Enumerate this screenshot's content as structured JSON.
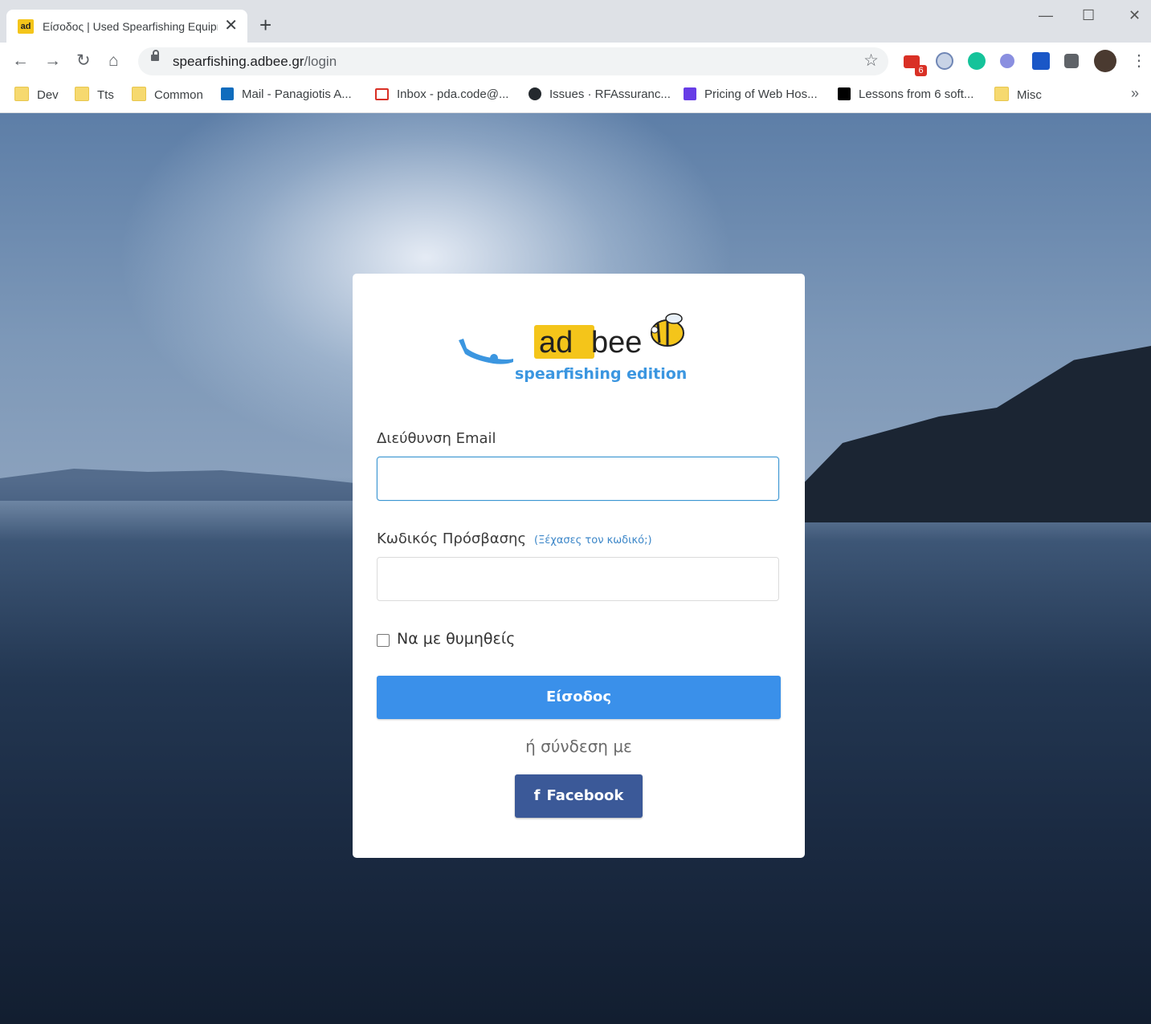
{
  "browser": {
    "tab_title": "Είσοδος | Used Spearfishing Equipment",
    "favicon_text": "ad",
    "tab_close": "✕",
    "new_tab": "+",
    "url_host": "spearfishing.adbee.gr",
    "url_path": "/login",
    "extension_badge": "6",
    "window_controls": {
      "minimize": "—",
      "maximize": "☐",
      "close": "✕"
    },
    "nav": {
      "back": "←",
      "forward": "→",
      "reload": "↻",
      "home": "⌂"
    }
  },
  "bookmarks": [
    {
      "label": "Dev",
      "icon": "folder-icon"
    },
    {
      "label": "Tts",
      "icon": "folder-icon"
    },
    {
      "label": "Common",
      "icon": "folder-icon"
    },
    {
      "label": "Mail - Panagiotis A...",
      "icon": "outlook-icon"
    },
    {
      "label": "Inbox - pda.code@...",
      "icon": "gmail-icon"
    },
    {
      "label": "Issues · RFAssuranc...",
      "icon": "github-icon"
    },
    {
      "label": "Pricing of Web Hos...",
      "icon": "hosting-icon"
    },
    {
      "label": "Lessons from 6 soft...",
      "icon": "medium-icon"
    },
    {
      "label": "Misc",
      "icon": "folder-icon"
    }
  ],
  "bookmarks_more": "»",
  "login": {
    "logo": {
      "ad": "ad",
      "bee": "bee",
      "tagline": "spearfishing edition"
    },
    "email_label": "Διεύθυνση Email",
    "email_value": "",
    "password_label": "Κωδικός Πρόσβασης",
    "forgot_link": "(Ξέχασες τον κωδικό;)",
    "password_value": "",
    "remember_label": "Να με θυμηθείς",
    "submit_label": "Είσοδος",
    "or_text": "ή σύνδεση με",
    "facebook_label": "Facebook",
    "facebook_icon": "f"
  },
  "colors": {
    "primary": "#3a90ea",
    "facebook": "#3b5998",
    "link": "#3b86c8",
    "logo_yellow": "#f4c51a",
    "logo_blue": "#3b96e0"
  }
}
